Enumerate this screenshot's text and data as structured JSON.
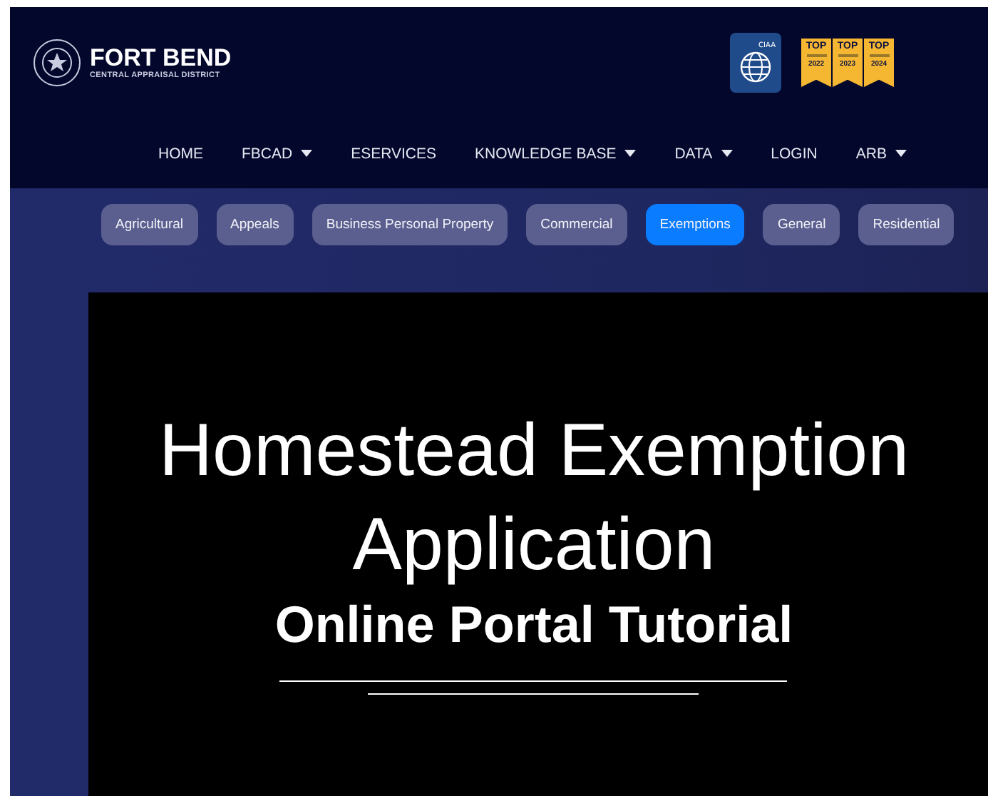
{
  "header": {
    "logo": {
      "title": "FORT BEND",
      "subtitle": "CENTRAL APPRAISAL DISTRICT"
    },
    "certification_badge": {
      "label": "CIAA"
    },
    "award_badges": [
      {
        "top": "TOP",
        "year": "2022"
      },
      {
        "top": "TOP",
        "year": "2023"
      },
      {
        "top": "TOP",
        "year": "2024"
      }
    ]
  },
  "nav": [
    {
      "label": "HOME",
      "dropdown": false
    },
    {
      "label": "FBCAD",
      "dropdown": true
    },
    {
      "label": "ESERVICES",
      "dropdown": false
    },
    {
      "label": "KNOWLEDGE BASE",
      "dropdown": true
    },
    {
      "label": "DATA",
      "dropdown": true
    },
    {
      "label": "LOGIN",
      "dropdown": false
    },
    {
      "label": "ARB",
      "dropdown": true
    }
  ],
  "categories": [
    {
      "label": "Agricultural",
      "selected": false
    },
    {
      "label": "Appeals",
      "selected": false
    },
    {
      "label": "Business Personal Property",
      "selected": false
    },
    {
      "label": "Commercial",
      "selected": false
    },
    {
      "label": "Exemptions",
      "selected": true
    },
    {
      "label": "General",
      "selected": false
    },
    {
      "label": "Residential",
      "selected": false
    }
  ],
  "video": {
    "title_lines": [
      "Homestead Exemption",
      "Application"
    ],
    "subtitle": "Online Portal Tutorial"
  }
}
